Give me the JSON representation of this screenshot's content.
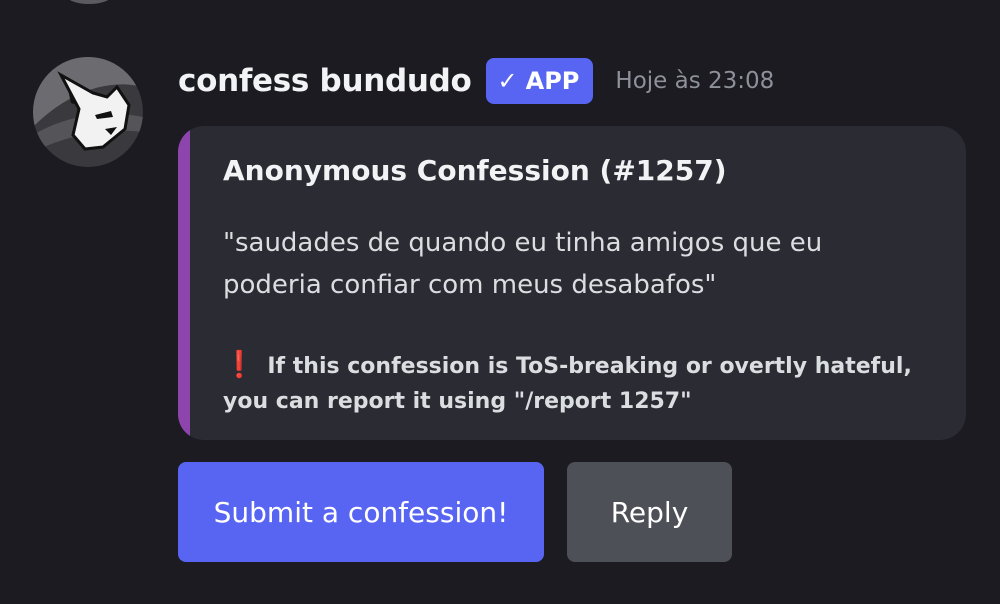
{
  "message": {
    "author": "confess bundudo",
    "badge": {
      "icon": "checkmark-icon",
      "check": "✓",
      "label": "APP"
    },
    "timestamp": "Hoje às 23:08"
  },
  "embed": {
    "accent_color": "#8e44ad",
    "title": "Anonymous Confession (#1257)",
    "description": "\"saudades de quando eu tinha amigos que eu poderia confiar com meus desabafos\"",
    "footer_icon": "❗",
    "footer_text": "If this confession is ToS-breaking or overtly hateful, you can report it using \"/report 1257\""
  },
  "buttons": {
    "submit_label": "Submit a confession!",
    "reply_label": "Reply"
  },
  "colors": {
    "background": "#1b1b21",
    "blurple": "#5865f2",
    "secondary_button": "#4e5058"
  }
}
